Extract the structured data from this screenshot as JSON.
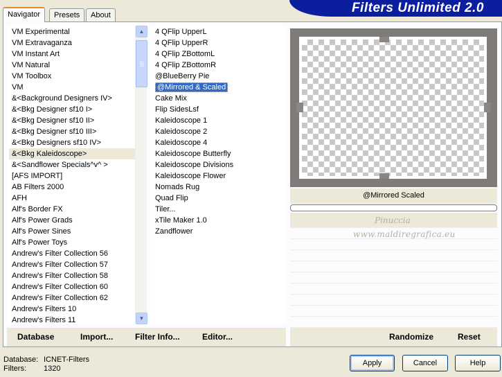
{
  "tabs": [
    "Navigator",
    "Presets",
    "About"
  ],
  "banner": {
    "title": "Filters Unlimited 2.0"
  },
  "categories": [
    "VM Experimental",
    "VM Extravaganza",
    "VM Instant Art",
    "VM Natural",
    "VM Toolbox",
    "VM",
    "&<Background Designers IV>",
    "&<Bkg Designer sf10 I>",
    "&<Bkg Designer sf10 II>",
    "&<Bkg Designer sf10 III>",
    "&<Bkg Designers sf10 IV>",
    "&<Bkg Kaleidoscope>",
    "&<Sandflower Specials^v^ >",
    "[AFS IMPORT]",
    "AB Filters 2000",
    "AFH",
    "Alf's Border FX",
    "Alf's Power Grads",
    "Alf's Power Sines",
    "Alf's Power Toys",
    "Andrew's Filter Collection 56",
    "Andrew's Filter Collection 57",
    "Andrew's Filter Collection 58",
    "Andrew's Filter Collection 60",
    "Andrew's Filter Collection 62",
    "Andrew's Filters 10",
    "Andrew's Filters 11"
  ],
  "selected_category": "&<Bkg Kaleidoscope>",
  "filters": [
    "4 QFlip UpperL",
    "4 QFlip UpperR",
    "4 QFlip ZBottomL",
    "4 QFlip ZBottomR",
    "@BlueBerry Pie",
    "@Mirrored & Scaled",
    "Cake Mix",
    "Flip SidesLsf",
    "Kaleidoscope 1",
    "Kaleidoscope 2",
    "Kaleidoscope 4",
    "Kaleidoscope Butterfly",
    "Kaleidoscope Divisions",
    "Kaleidoscope Flower",
    "Nomads Rug",
    "Quad Flip",
    "Tiler...",
    "xTile Maker 1.0",
    "Zandflower"
  ],
  "selected_filter": "@Mirrored & Scaled",
  "bottom_buttons": {
    "database": "Database",
    "import": "Import...",
    "filter_info": "Filter Info...",
    "editor": "Editor...",
    "randomize": "Randomize",
    "reset": "Reset"
  },
  "preview": {
    "filter_name": "@Mirrored  Scaled",
    "watermark_line1": "Pinuccia",
    "watermark_line2": "www.maldiregrafica.eu"
  },
  "status": {
    "database_label": "Database:",
    "database_value": "ICNET-Filters",
    "filters_label": "Filters:",
    "filters_value": "1320"
  },
  "dialog_buttons": {
    "apply": "Apply",
    "cancel": "Cancel",
    "help": "Help"
  },
  "colors": {
    "banner": "#0b1e9e",
    "selection": "#316ac5",
    "face": "#ece9d8"
  },
  "icons": {
    "scroll_up": "chevron-up-icon",
    "scroll_down": "chevron-down-icon"
  }
}
